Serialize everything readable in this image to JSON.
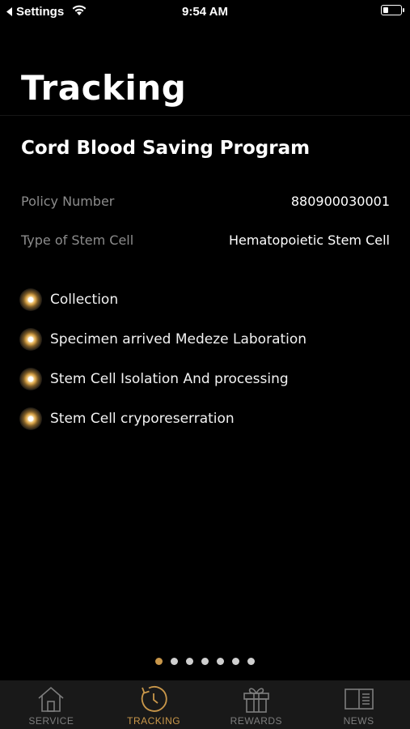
{
  "status_bar": {
    "back_label": "Settings",
    "time": "9:54 AM"
  },
  "page": {
    "title": "Tracking"
  },
  "program": {
    "title": "Cord Blood Saving Program",
    "policy_label": "Policy Number",
    "policy_value": "880900030001",
    "stem_cell_label": "Type of Stem Cell",
    "stem_cell_value": "Hematopoietic Stem Cell"
  },
  "steps": [
    {
      "label": "Collection"
    },
    {
      "label": "Specimen arrived Medeze Laboration"
    },
    {
      "label": "Stem Cell Isolation And processing"
    },
    {
      "label": "Stem Cell cryporeserration"
    }
  ],
  "pager": {
    "active_index": 0
  },
  "tabbar": {
    "items": [
      {
        "label": "SERVICE",
        "icon": "house-icon"
      },
      {
        "label": "TRACKING",
        "icon": "clock-icon"
      },
      {
        "label": "REWARDS",
        "icon": "gift-icon"
      },
      {
        "label": "NEWS",
        "icon": "book-icon"
      }
    ]
  },
  "colors": {
    "accent": "#c9974a",
    "tab_inactive": "#7d7d7d",
    "background": "#000000",
    "tabbar_background": "#191919"
  }
}
